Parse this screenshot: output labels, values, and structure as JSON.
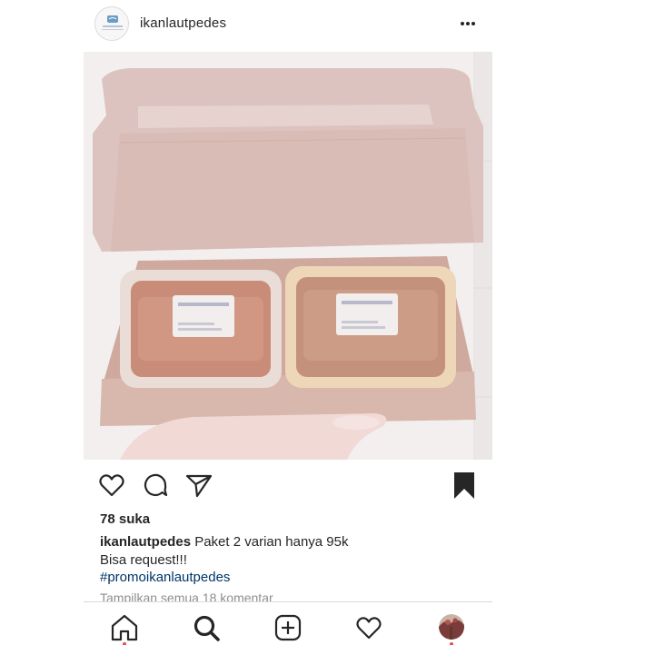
{
  "header": {
    "username": "ikanlautpedes",
    "avatar_icon": "brand-logo-icon",
    "more_icon": "more-options-icon"
  },
  "photo": {
    "subject": "product-photo"
  },
  "actions": {
    "like_icon": "heart-icon",
    "comment_icon": "comment-icon",
    "share_icon": "send-icon",
    "save_icon": "bookmark-icon"
  },
  "likes": "78 suka",
  "caption": {
    "user": "ikanlautpedes",
    "line1": " Paket 2 varian hanya 95k",
    "line2": "Bisa request!!!",
    "hashtag": "#promoikanlautpedes"
  },
  "comments_link": "Tampilkan semua 18 komentar",
  "bottom_nav": {
    "items": [
      "home-icon",
      "search-icon",
      "new-post-icon",
      "activity-icon",
      "profile-avatar"
    ],
    "accent": "#ed4956"
  }
}
